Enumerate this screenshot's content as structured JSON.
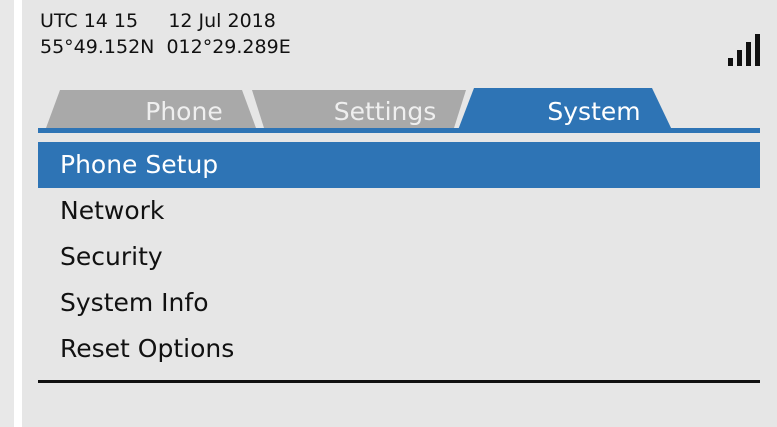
{
  "status": {
    "utc_time": "UTC 14 15",
    "date": "12 Jul 2018",
    "position": "55°49.152N  012°29.289E",
    "signal_icon": "signal-bars-icon"
  },
  "tabs": [
    {
      "label": "Phone",
      "active": false
    },
    {
      "label": "Settings",
      "active": false
    },
    {
      "label": "System",
      "active": true
    }
  ],
  "menu": {
    "items": [
      {
        "label": "Phone Setup",
        "selected": true
      },
      {
        "label": "Network",
        "selected": false
      },
      {
        "label": "Security",
        "selected": false
      },
      {
        "label": "System Info",
        "selected": false
      },
      {
        "label": "Reset Options",
        "selected": false
      }
    ]
  },
  "colors": {
    "accent": "#2e74b5",
    "tab_inactive": "#a9a9a9",
    "background": "#e6e6e6"
  }
}
